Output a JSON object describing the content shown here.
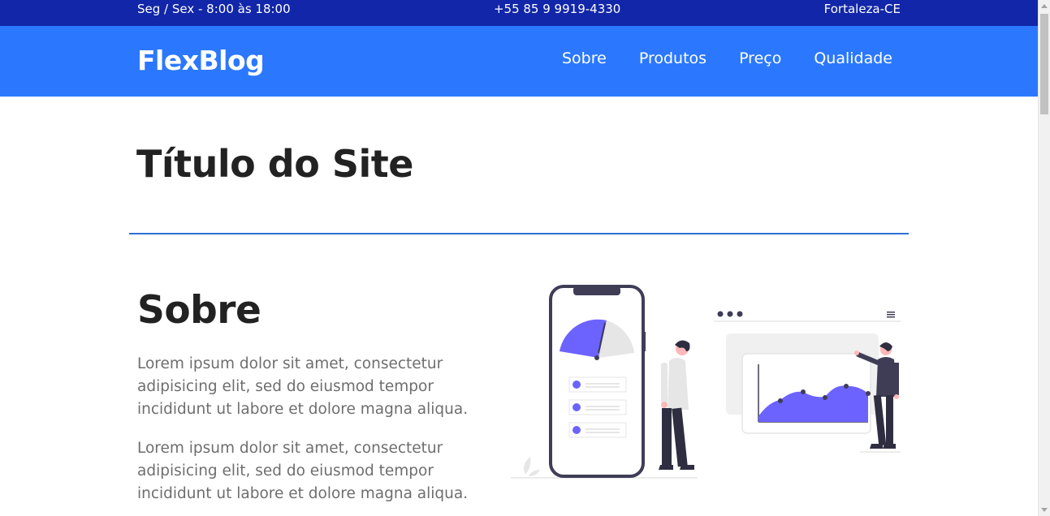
{
  "topbar": {
    "hours": "Seg / Sex - 8:00 às 18:00",
    "phone": "+55 85 9 9919-4330",
    "location": "Fortaleza-CE"
  },
  "navbar": {
    "logo": "FlexBlog",
    "items": [
      {
        "label": "Sobre"
      },
      {
        "label": "Produtos"
      },
      {
        "label": "Preço"
      },
      {
        "label": "Qualidade"
      }
    ]
  },
  "hero": {
    "title": "Título do Site"
  },
  "about": {
    "heading": "Sobre",
    "paragraphs": [
      "Lorem ipsum dolor sit amet, consectetur adipisicing elit, sed do eiusmod tempor incididunt ut labore et dolore magna aliqua.",
      "Lorem ipsum dolor sit amet, consectetur adipisicing elit, sed do eiusmod tempor incididunt ut labore et dolore magna aliqua."
    ],
    "illustration": "analytics-illustration"
  },
  "colors": {
    "topbar": "#1126a8",
    "navbar": "#2b78ff",
    "accent": "#6c63ff",
    "divider": "#2f6fd6"
  }
}
